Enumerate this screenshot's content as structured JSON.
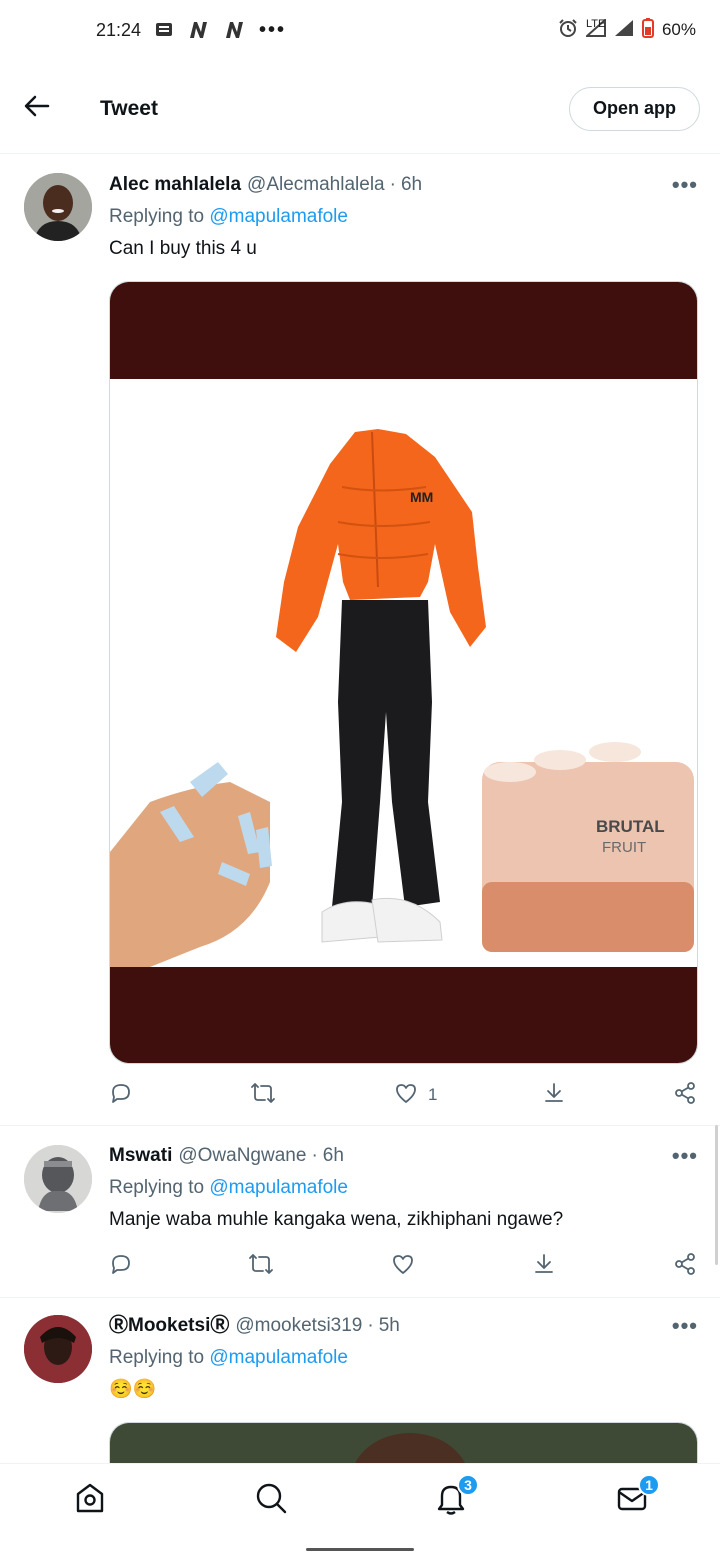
{
  "status_bar": {
    "time": "21:24",
    "notif_icons": [
      "message-icon",
      "n-app-icon",
      "n-app-icon"
    ],
    "more": "•••",
    "lte": "LTE",
    "battery": "60%"
  },
  "header": {
    "title": "Tweet",
    "open_app": "Open app"
  },
  "tweets": [
    {
      "name": "Alec mahlalela",
      "handle": "@Alecmahlalela",
      "dot": "·",
      "time": "6h",
      "reply_prefix": "Replying to",
      "reply_to": "@mapulamafole",
      "text": "Can I buy this 4 u",
      "likes": "1",
      "media_colors": {
        "band": "#3e0f0c",
        "jacket": "#f4661c",
        "pants": "#1b1b1e",
        "nails": "#bcd9ee",
        "skin": "#e0a77f",
        "drink": "#ecc4b0"
      }
    },
    {
      "name": "Mswati",
      "handle": "@OwaNgwane",
      "dot": "·",
      "time": "6h",
      "reply_prefix": "Replying to",
      "reply_to": "@mapulamafole",
      "text": "Manje waba muhle kangaka wena, zikhiphani ngawe?"
    },
    {
      "name": "ⓇMooketsiⓇ",
      "handle": "@mooketsi319",
      "dot": "·",
      "time": "5h",
      "reply_prefix": "Replying to",
      "reply_to": "@mapulamafole",
      "text": "☺️☺️"
    }
  ],
  "more_label": "•••",
  "bottom_nav": {
    "items": [
      "home-icon",
      "search-icon",
      "notifications-icon",
      "messages-icon"
    ],
    "notifications_badge": "3",
    "messages_badge": "1"
  },
  "accent": "#1d9bf0"
}
